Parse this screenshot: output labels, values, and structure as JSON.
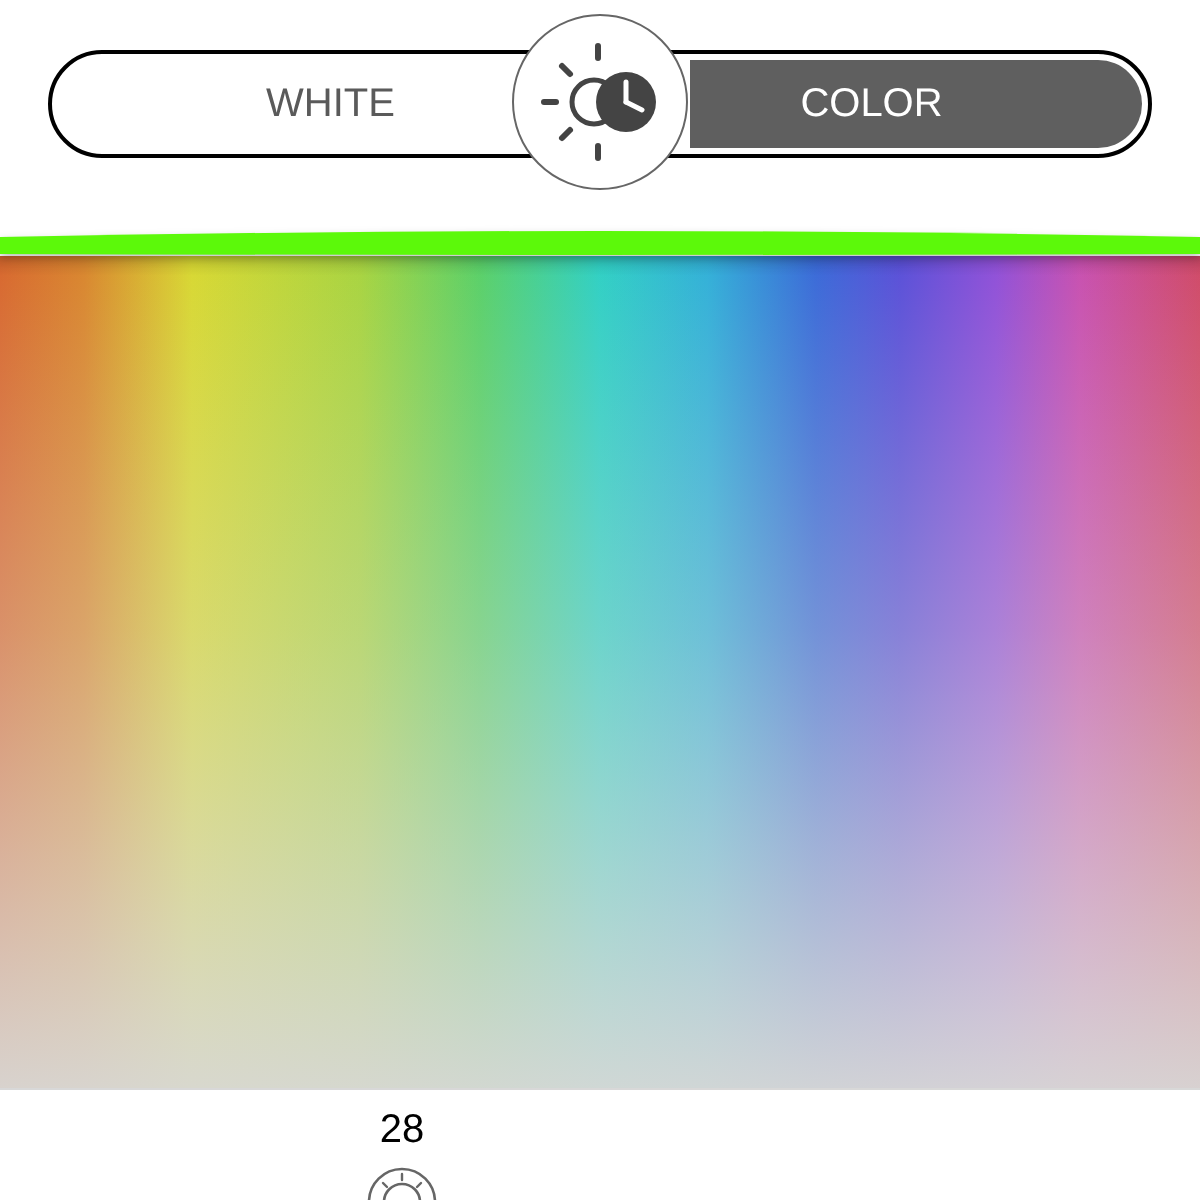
{
  "mode_switch": {
    "options": [
      {
        "label": "WHITE",
        "selected": false
      },
      {
        "label": "COLOR",
        "selected": true
      }
    ]
  },
  "color_picker": {
    "indicator": {
      "color": "#5cf90a"
    }
  },
  "readout": {
    "value": "28"
  }
}
